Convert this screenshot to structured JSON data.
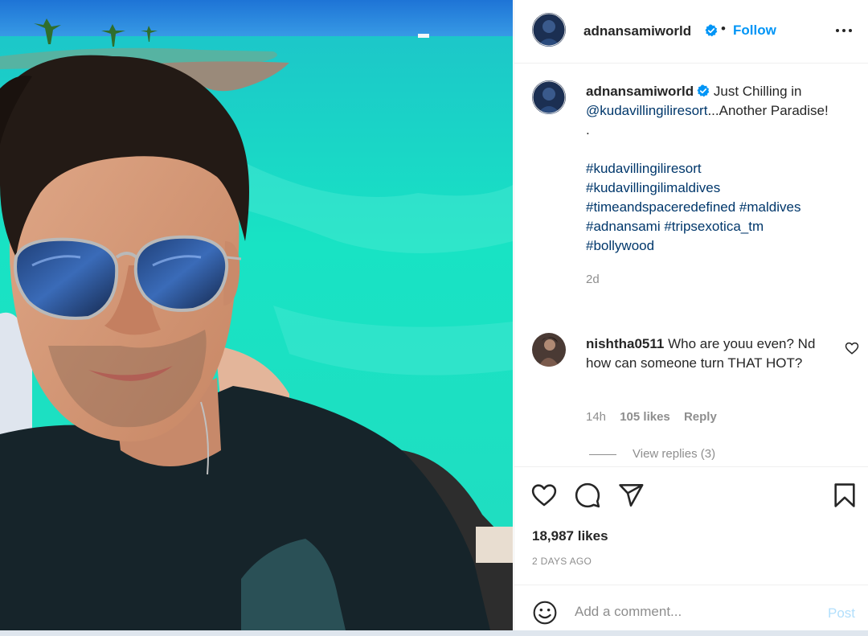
{
  "post": {
    "username": "adnansamiworld",
    "follow_label": "Follow",
    "separator": "•",
    "more_icon": "more-horizontal-icon",
    "verified_color": "#0095f6"
  },
  "caption": {
    "username": "adnansamiworld",
    "text_before_mention": "Just Chilling in",
    "mention": "@kudavillingiliresort",
    "text_after_mention": "...Another Paradise!",
    "dot": ".",
    "hashtags_line1": "#kudavillingiliresort",
    "hashtags_line2": "#kudavillingilimaldives",
    "hashtags_line3": "#timeandspaceredefined #maldives",
    "hashtags_line4": "#adnansami #tripsexotica_tm",
    "hashtags_line5": "#bollywood",
    "time": "2d"
  },
  "comment": {
    "username": "nishtha0511",
    "text": "Who are youu even? Nd how can someone turn THAT HOT?",
    "time": "14h",
    "likes": "105 likes",
    "reply_label": "Reply",
    "view_replies": "View replies (3)"
  },
  "actions": {
    "like_count": "18,987 likes",
    "posted_ago": "2 DAYS AGO",
    "icons": [
      "heart-icon",
      "comment-icon",
      "share-icon",
      "bookmark-icon"
    ]
  },
  "composer": {
    "placeholder": "Add a comment...",
    "post_label": "Post"
  },
  "colors": {
    "accent": "#0095f6",
    "link": "#00376b",
    "muted": "#8e8e8e",
    "post_disabled": "#b2dffc"
  }
}
